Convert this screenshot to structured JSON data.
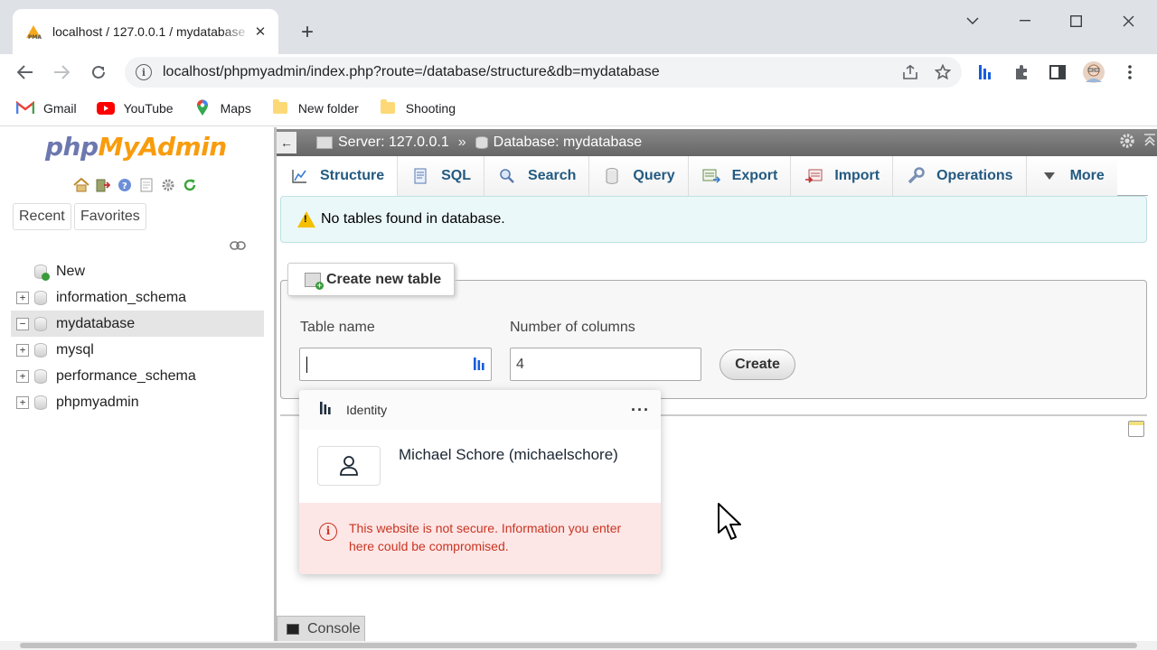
{
  "browser": {
    "tab_title": "localhost / 127.0.0.1 / mydatabase",
    "tab_close": "✕",
    "new_tab": "+",
    "url": "localhost/phpmyadmin/index.php?route=/database/structure&db=mydatabase",
    "bookmarks": [
      {
        "label": "Gmail",
        "icon": "gmail-icon"
      },
      {
        "label": "YouTube",
        "icon": "youtube-icon"
      },
      {
        "label": "Maps",
        "icon": "maps-icon"
      },
      {
        "label": "New folder",
        "icon": "folder-icon"
      },
      {
        "label": "Shooting",
        "icon": "folder-icon"
      }
    ]
  },
  "pma": {
    "logo_part1": "php",
    "logo_part2": "MyAdmin",
    "recent_label": "Recent",
    "favorites_label": "Favorites",
    "tree": [
      {
        "label": "New",
        "type": "new"
      },
      {
        "label": "information_schema",
        "type": "db",
        "toggle": "+"
      },
      {
        "label": "mydatabase",
        "type": "db",
        "toggle": "−",
        "selected": true
      },
      {
        "label": "mysql",
        "type": "db",
        "toggle": "+"
      },
      {
        "label": "performance_schema",
        "type": "db",
        "toggle": "+"
      },
      {
        "label": "phpmyadmin",
        "type": "db",
        "toggle": "+"
      }
    ],
    "breadcrumb": {
      "server": "Server: 127.0.0.1",
      "separator": "»",
      "database": "Database: mydatabase"
    },
    "tabs": [
      {
        "label": "Structure",
        "icon": "structure-icon"
      },
      {
        "label": "SQL",
        "icon": "sql-icon"
      },
      {
        "label": "Search",
        "icon": "search-icon"
      },
      {
        "label": "Query",
        "icon": "query-icon"
      },
      {
        "label": "Export",
        "icon": "export-icon"
      },
      {
        "label": "Import",
        "icon": "import-icon"
      },
      {
        "label": "Operations",
        "icon": "operations-icon"
      },
      {
        "label": "More",
        "icon": "more-caret-icon"
      }
    ],
    "notice": "No tables found in database.",
    "create_table": {
      "legend": "Create new table",
      "table_name_label": "Table name",
      "table_name_value": "",
      "columns_label": "Number of columns",
      "columns_value": "4",
      "create_button": "Create"
    },
    "console_label": "Console"
  },
  "bitwarden": {
    "title": "Identity",
    "dots": "···",
    "entry_name": "Michael Schore (michaelschore)",
    "warning": "This website is not secure. Information you enter here could be compromised."
  },
  "colors": {
    "pma_link": "#235a81",
    "notice_bg": "#ebf8fa",
    "warning_text": "#c83522",
    "warning_bg": "#fde6e6"
  }
}
